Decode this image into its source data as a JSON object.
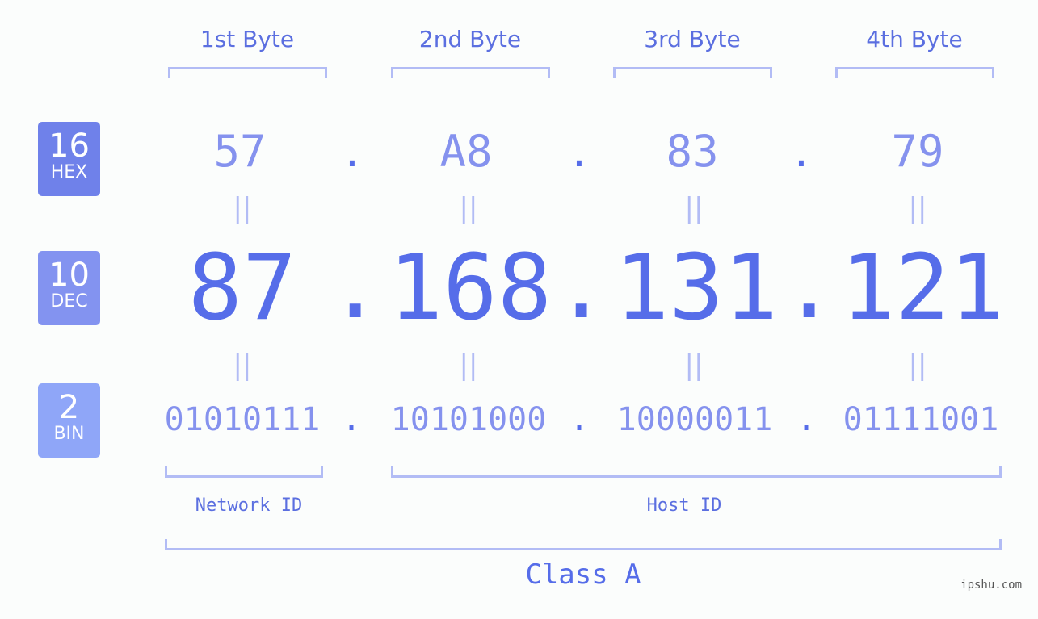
{
  "byte_headers": [
    "1st Byte",
    "2nd Byte",
    "3rd Byte",
    "4th Byte"
  ],
  "badges": {
    "hex": {
      "number": "16",
      "label": "HEX",
      "color": "#6f81ea"
    },
    "dec": {
      "number": "10",
      "label": "DEC",
      "color": "#8393f0"
    },
    "bin": {
      "number": "2",
      "label": "BIN",
      "color": "#8fa6f8"
    }
  },
  "hex": [
    "57",
    "A8",
    "83",
    "79"
  ],
  "dec": [
    "87",
    "168",
    "131",
    "121"
  ],
  "bin": [
    "01010111",
    "10101000",
    "10000011",
    "01111001"
  ],
  "separator": ".",
  "equals": "||",
  "network_label": "Network ID",
  "host_label": "Host ID",
  "class_label": "Class A",
  "watermark": "ipshu.com",
  "colors": {
    "primary": "#566de9",
    "light": "#8592ee",
    "bracket": "#b2bcf5"
  }
}
